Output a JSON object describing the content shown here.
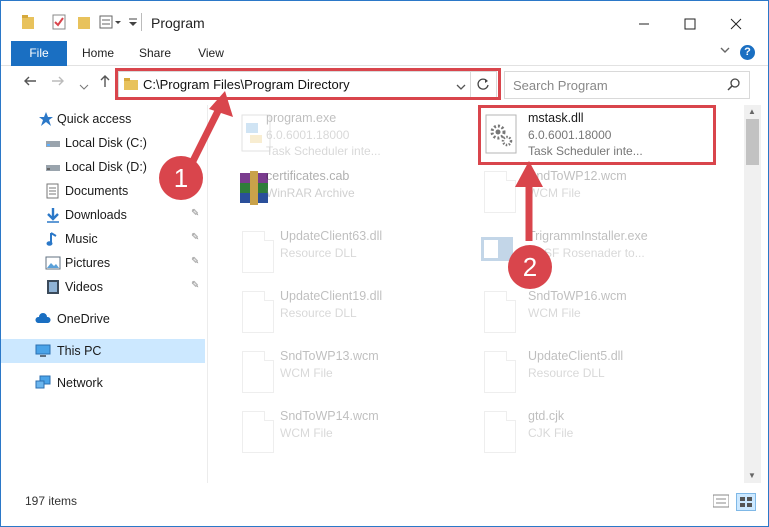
{
  "window": {
    "title": "Program",
    "controls": {
      "minimize_icon": "minimize-icon",
      "maximize_icon": "maximize-icon",
      "close_icon": "close-icon"
    }
  },
  "ribbon": {
    "tabs": [
      "File",
      "Home",
      "Share",
      "View"
    ],
    "help": "?",
    "expand_icon": "chevron-down-icon"
  },
  "navigation": {
    "address": "C:\\Program Files\\Program Directory",
    "search_placeholder": "Search Program"
  },
  "sidebar": {
    "items": [
      {
        "label": "Quick access",
        "icon": "star-icon"
      },
      {
        "label": "Local Disk (C:)",
        "icon": "drive-icon"
      },
      {
        "label": "Local Disk (D:)",
        "icon": "drive-icon"
      },
      {
        "label": "Documents",
        "icon": "documents-icon"
      },
      {
        "label": "Downloads",
        "icon": "downloads-icon",
        "pinned": true
      },
      {
        "label": "Music",
        "icon": "music-icon",
        "pinned": true
      },
      {
        "label": "Pictures",
        "icon": "pictures-icon",
        "pinned": true
      },
      {
        "label": "Videos",
        "icon": "videos-icon",
        "pinned": true
      },
      {
        "label": "OneDrive",
        "icon": "cloud-icon"
      },
      {
        "label": "This PC",
        "icon": "computer-icon",
        "selected": true
      },
      {
        "label": "Network",
        "icon": "network-icon"
      }
    ]
  },
  "files": [
    {
      "name": "program.exe",
      "line2": "6.0.6001.18000",
      "line3": "Task Scheduler inte...",
      "icon": "exe-icon"
    },
    {
      "name": "mstask.dll",
      "line2": "6.0.6001.18000",
      "line3": "Task Scheduler inte...",
      "icon": "dll-gear-icon",
      "highlighted": true
    },
    {
      "name": "certificates.cab",
      "line2": "WinRAR Archive",
      "line3": "",
      "icon": "winrar-icon"
    },
    {
      "name": "SndToWP12.wcm",
      "line2": "WCM File",
      "line3": "",
      "icon": "file-icon"
    },
    {
      "name": "UpdateClient63.dll",
      "line2": "Resource DLL",
      "line3": "",
      "icon": "dll-gear-icon"
    },
    {
      "name": "TrigrammInstaller.exe",
      "line2": "BASF Rosenader to...",
      "line3": "",
      "icon": "installer-icon"
    },
    {
      "name": "UpdateClient19.dll",
      "line2": "Resource DLL",
      "line3": "",
      "icon": "dll-gear-icon"
    },
    {
      "name": "SndToWP16.wcm",
      "line2": "WCM File",
      "line3": "",
      "icon": "file-icon"
    },
    {
      "name": "SndToWP13.wcm",
      "line2": "WCM File",
      "line3": "",
      "icon": "file-icon"
    },
    {
      "name": "UpdateClient5.dll",
      "line2": "Resource DLL",
      "line3": "",
      "icon": "dll-gear-icon"
    },
    {
      "name": "SndToWP14.wcm",
      "line2": "WCM File",
      "line3": "",
      "icon": "file-icon"
    },
    {
      "name": "gtd.cjk",
      "line2": "CJK File",
      "line3": "",
      "icon": "file-icon"
    }
  ],
  "status": {
    "item_count": "197 items"
  },
  "annotations": {
    "badge1": "1",
    "badge2": "2",
    "color": "#d9454c"
  },
  "colors": {
    "accent": "#1a6fc2",
    "selected_bg": "#cce8ff",
    "annotation": "#d9454c"
  }
}
